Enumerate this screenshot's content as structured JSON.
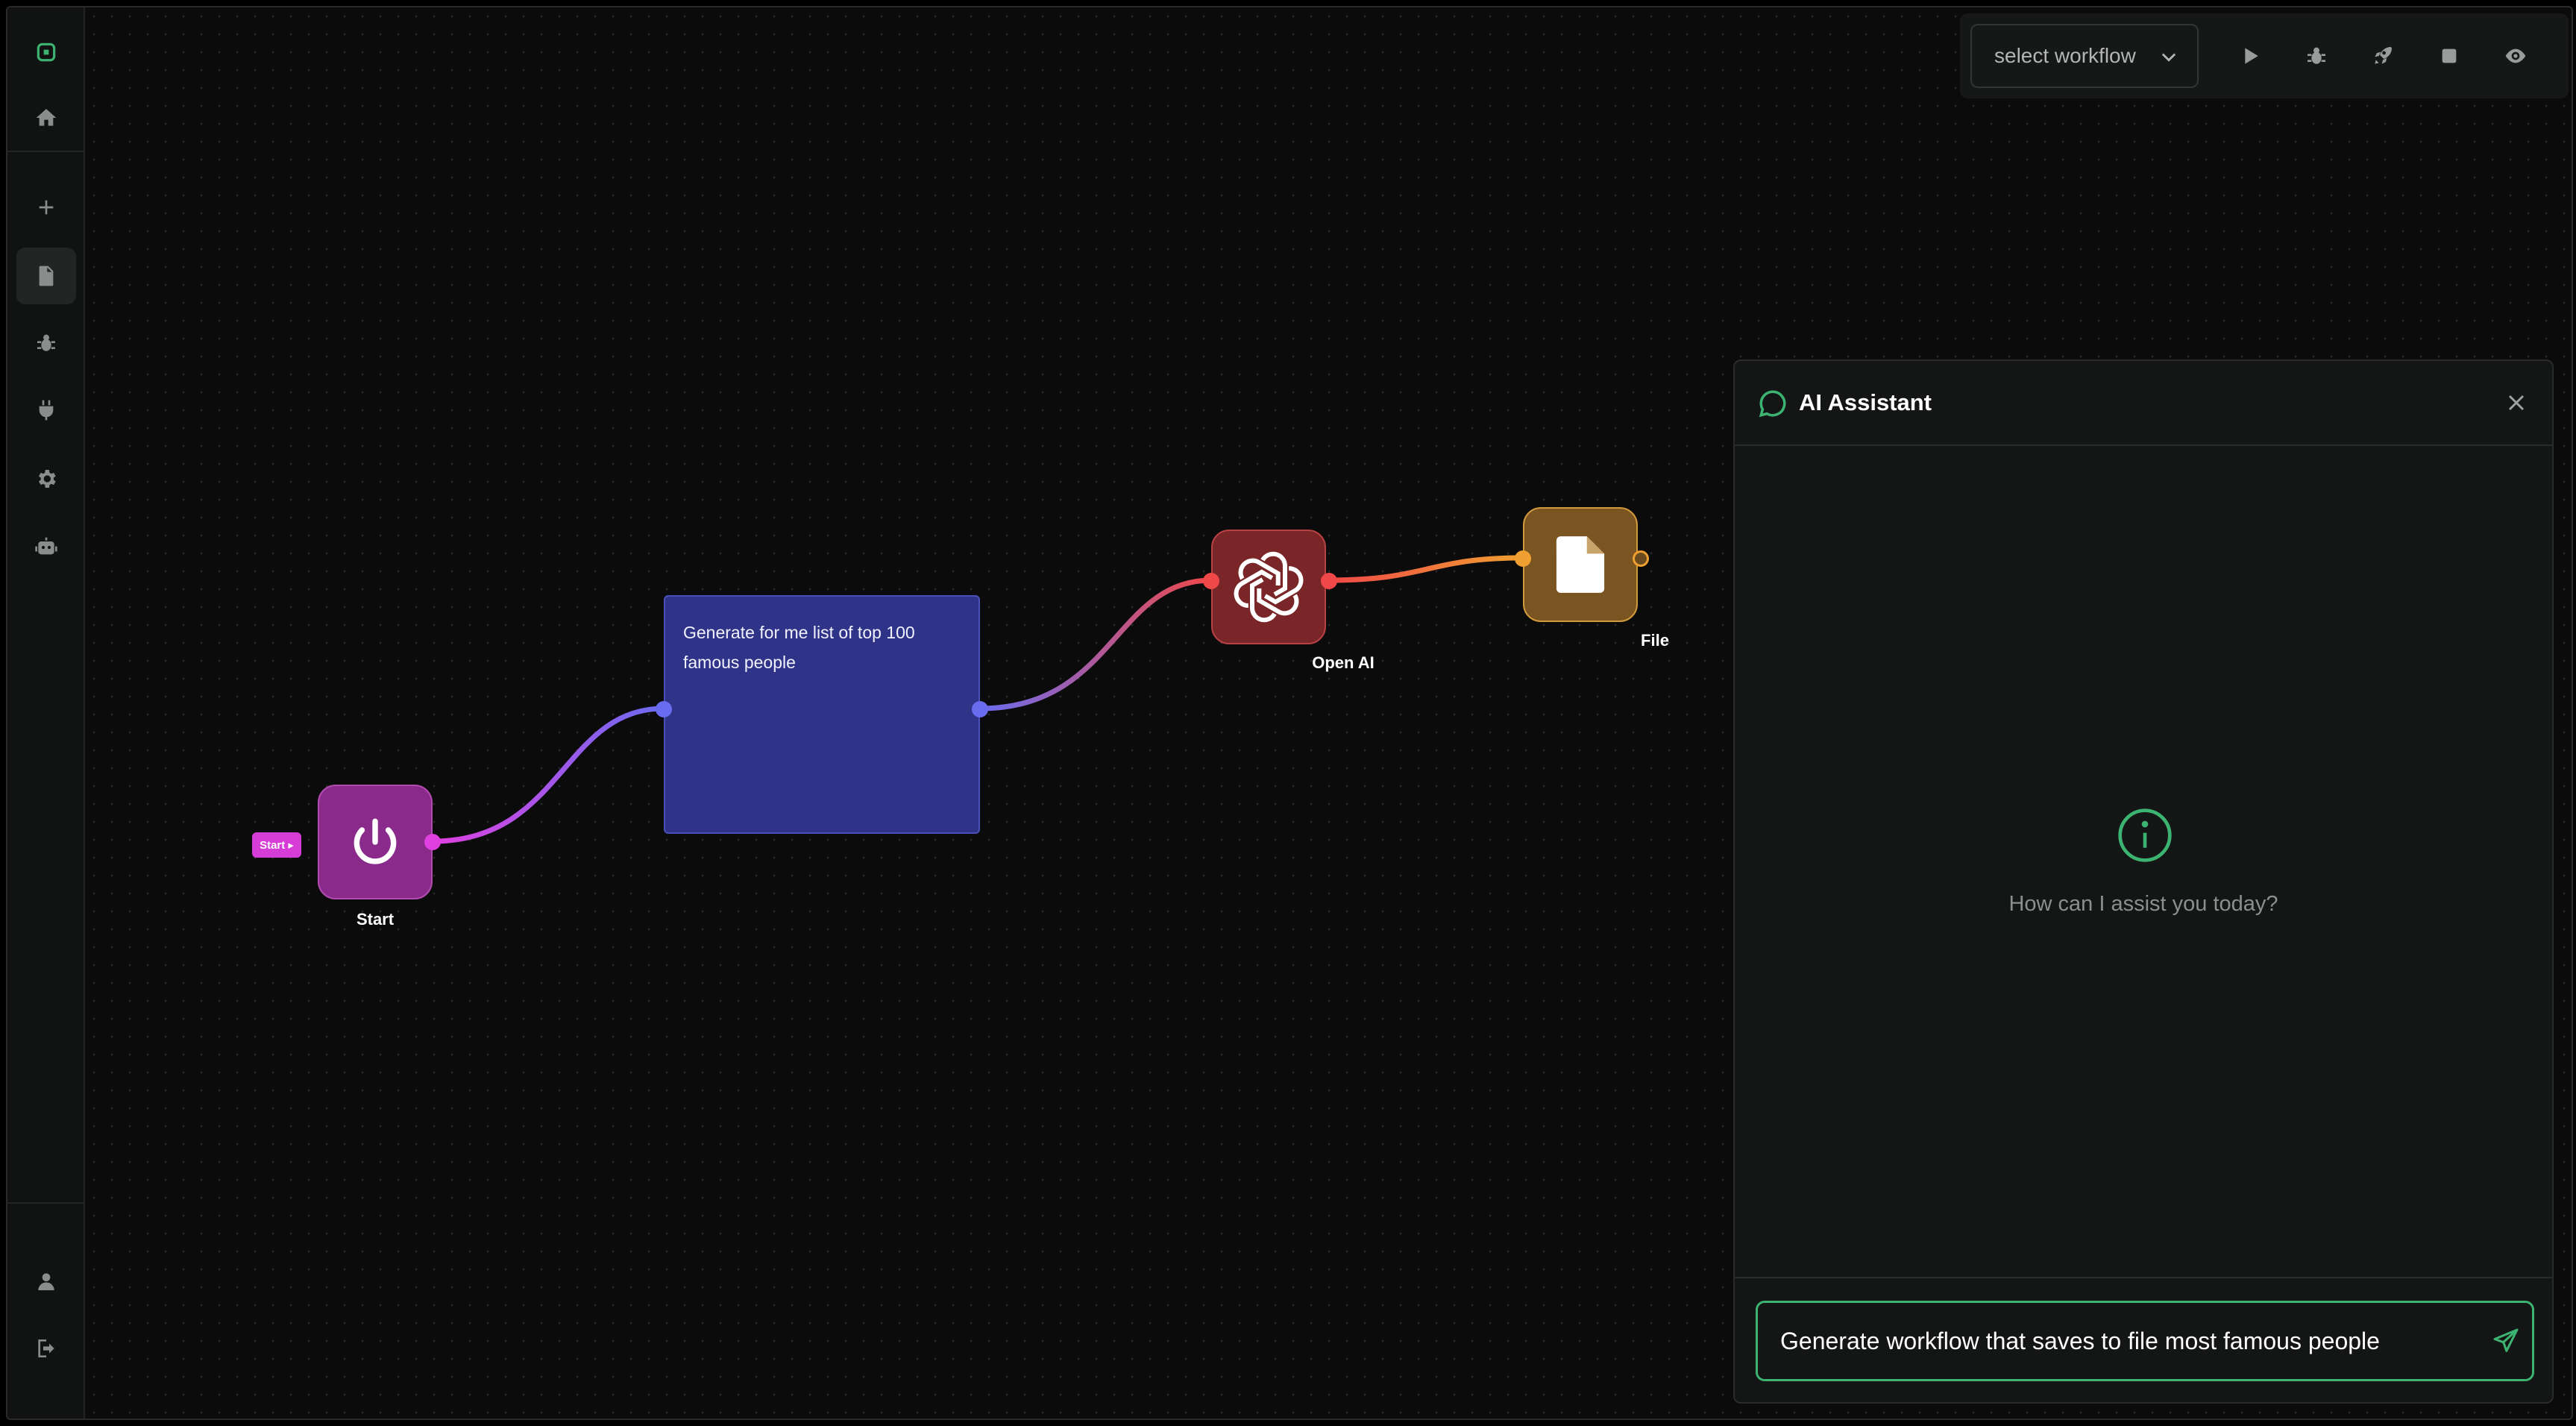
{
  "sidebar": {
    "items": [
      {
        "name": "logo-icon"
      },
      {
        "name": "home-icon"
      },
      {
        "name": "plus-icon"
      },
      {
        "name": "document-icon",
        "active": true
      },
      {
        "name": "bug-icon"
      },
      {
        "name": "plug-icon"
      },
      {
        "name": "gear-icon"
      },
      {
        "name": "robot-icon"
      },
      {
        "name": "user-icon"
      },
      {
        "name": "logout-icon"
      }
    ]
  },
  "toolbar": {
    "workflow_select": "select workflow",
    "buttons": [
      "play-icon",
      "bug-icon",
      "rocket-icon",
      "stop-icon",
      "eye-icon"
    ]
  },
  "nodes": {
    "start": {
      "label": "Start",
      "tag": "Start ▸",
      "color": "#8a2a8a"
    },
    "prompt": {
      "text": "Generate for me list of top 100 famous people",
      "color": "#2f3488"
    },
    "openai": {
      "label": "Open AI",
      "color": "#7a2628"
    },
    "file": {
      "label": "File",
      "color": "#7a5522"
    }
  },
  "assistant": {
    "title": "AI Assistant",
    "empty_message": "How can I assist you today?",
    "input_value": "Generate workflow that saves to file most famous people",
    "accent": "#3cb371"
  }
}
